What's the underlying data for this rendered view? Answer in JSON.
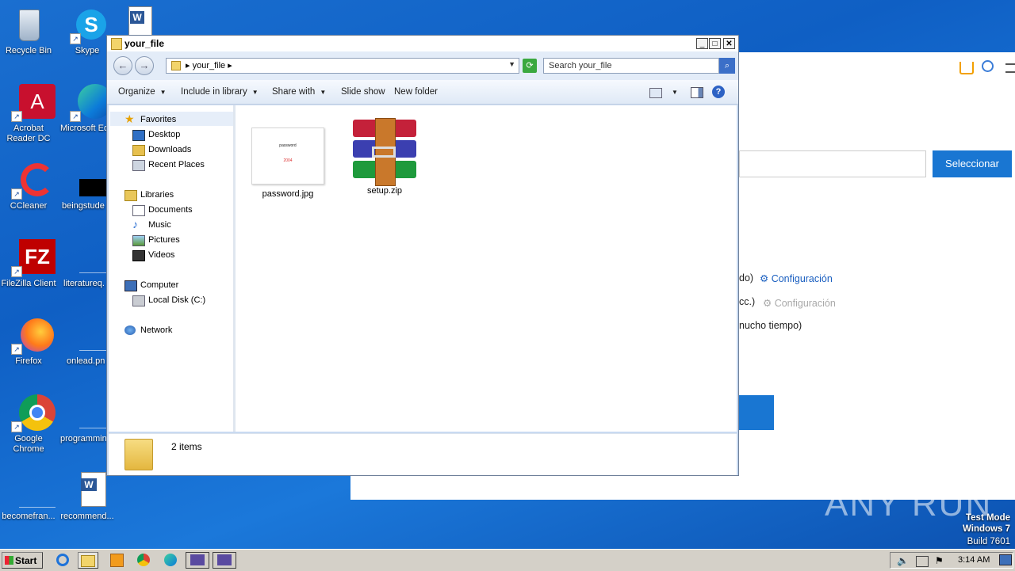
{
  "desktop": {
    "icons": [
      {
        "label": "Recycle Bin"
      },
      {
        "label": "Skype"
      },
      {
        "label": "Acrobat Reader DC"
      },
      {
        "label": "Microsoft Ed"
      },
      {
        "label": "CCleaner"
      },
      {
        "label": "beingstude"
      },
      {
        "label": "FileZilla Client"
      },
      {
        "label": "literatureq."
      },
      {
        "label": "Firefox"
      },
      {
        "label": "onlead.pn"
      },
      {
        "label": "Google Chrome"
      },
      {
        "label": "programmin"
      },
      {
        "label": "becomefran..."
      },
      {
        "label": "recommend..."
      }
    ]
  },
  "background_browser": {
    "select_button": "Seleccionar",
    "line1_text": "do)",
    "line1_link": "Configuración",
    "line2_text": "cc.)",
    "line2_link": "Configuración",
    "line3_text": "nucho tiempo)"
  },
  "explorer": {
    "title": "your_file",
    "address_crumb": "your_file",
    "search_placeholder": "Search your_file",
    "toolbar": {
      "organize": "Organize",
      "include_in_library": "Include in library",
      "share_with": "Share with",
      "slide_show": "Slide show",
      "new_folder": "New folder"
    },
    "nav": {
      "favorites": "Favorites",
      "desktop": "Desktop",
      "downloads": "Downloads",
      "recent_places": "Recent Places",
      "libraries": "Libraries",
      "documents": "Documents",
      "music": "Music",
      "pictures": "Pictures",
      "videos": "Videos",
      "computer": "Computer",
      "local_disk": "Local Disk (C:)",
      "network": "Network"
    },
    "files": [
      {
        "name": "password.jpg",
        "thumb_line1": "password",
        "thumb_line2": "2004"
      },
      {
        "name": "setup.zip"
      }
    ],
    "status": "2 items"
  },
  "watermark": "ANY RUN",
  "testmode": {
    "line1": "Test Mode",
    "line2": "Windows 7",
    "line3": "Build 7601"
  },
  "taskbar": {
    "start": "Start",
    "clock": "3:14 AM"
  }
}
